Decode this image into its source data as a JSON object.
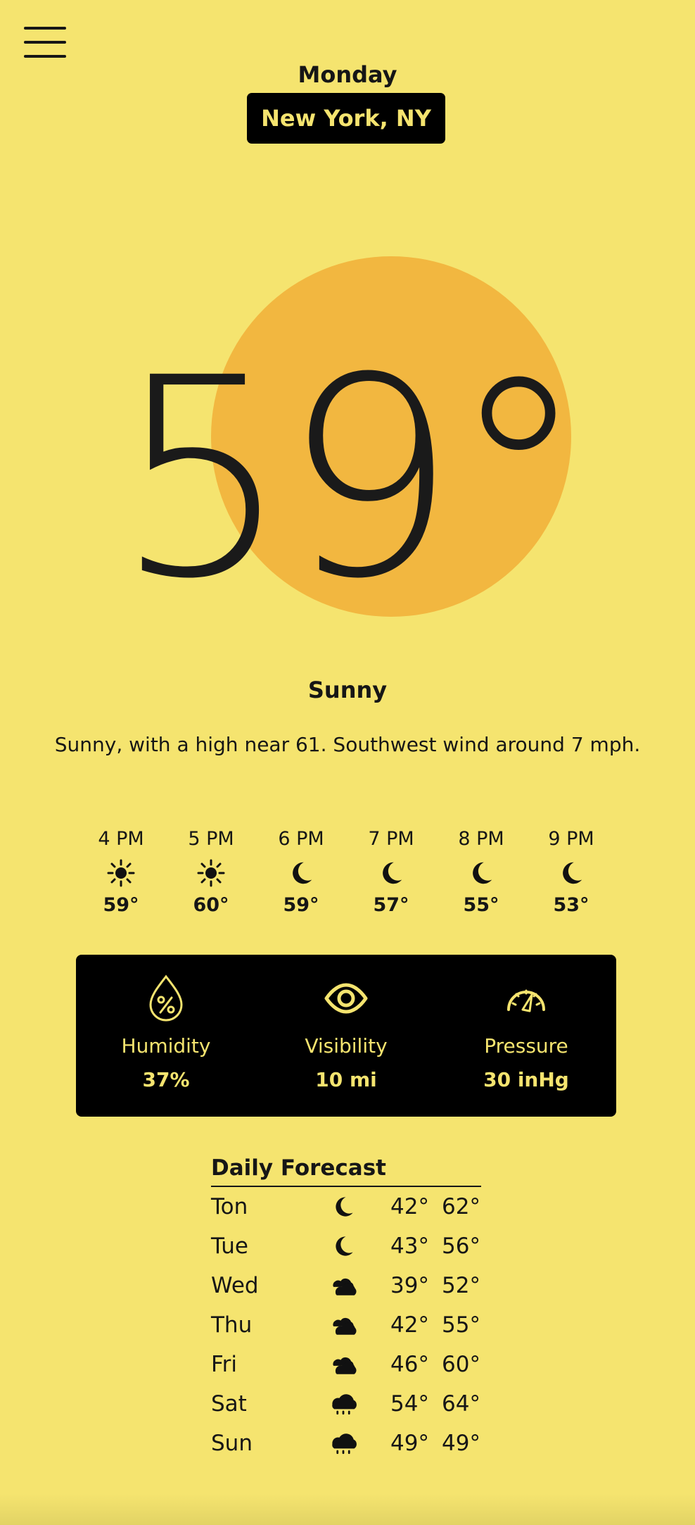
{
  "header": {
    "day": "Monday",
    "location": "New York, NY"
  },
  "current": {
    "temperature": "59°",
    "condition": "Sunny",
    "description": "Sunny, with a high near 61. Southwest wind around 7 mph.",
    "sun_color": "#F2B740"
  },
  "hourly": [
    {
      "time": "4 PM",
      "icon": "sun-icon",
      "temp": "59°"
    },
    {
      "time": "5 PM",
      "icon": "sun-icon",
      "temp": "60°"
    },
    {
      "time": "6 PM",
      "icon": "moon-icon",
      "temp": "59°"
    },
    {
      "time": "7 PM",
      "icon": "moon-icon",
      "temp": "57°"
    },
    {
      "time": "8 PM",
      "icon": "moon-icon",
      "temp": "55°"
    },
    {
      "time": "9 PM",
      "icon": "moon-icon",
      "temp": "53°"
    }
  ],
  "stats": {
    "humidity": {
      "label": "Humidity",
      "value": "37%",
      "icon": "humidity-icon"
    },
    "visibility": {
      "label": "Visibility",
      "value": "10 mi",
      "icon": "eye-icon"
    },
    "pressure": {
      "label": "Pressure",
      "value": "30 inHg",
      "icon": "gauge-icon"
    }
  },
  "daily": {
    "title": "Daily Forecast",
    "days": [
      {
        "day": "Ton",
        "icon": "moon-icon",
        "low": "42°",
        "high": "62°"
      },
      {
        "day": "Tue",
        "icon": "moon-icon",
        "low": "43°",
        "high": "56°"
      },
      {
        "day": "Wed",
        "icon": "cloud-icon",
        "low": "39°",
        "high": "52°"
      },
      {
        "day": "Thu",
        "icon": "cloud-icon",
        "low": "42°",
        "high": "55°"
      },
      {
        "day": "Fri",
        "icon": "cloud-icon",
        "low": "46°",
        "high": "60°"
      },
      {
        "day": "Sat",
        "icon": "rain-icon",
        "low": "54°",
        "high": "64°"
      },
      {
        "day": "Sun",
        "icon": "rain-icon",
        "low": "49°",
        "high": "49°"
      }
    ]
  },
  "colors": {
    "background": "#F5E46F",
    "panel": "#000000",
    "accent_text": "#F5E46F",
    "text": "#161616"
  }
}
